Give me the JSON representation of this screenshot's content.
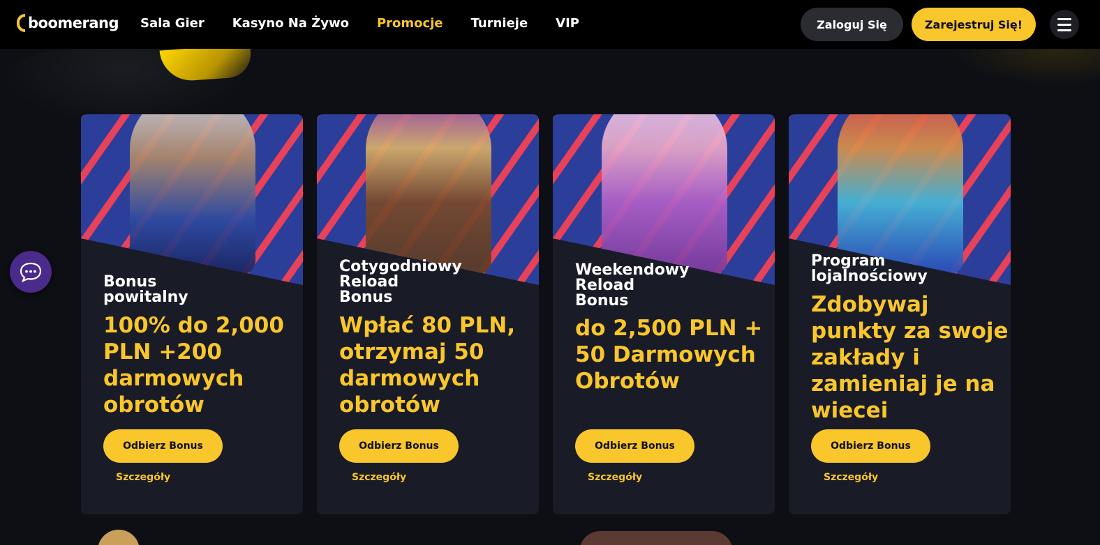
{
  "header": {
    "logo_text": "boomerang",
    "nav": [
      "Sala Gier",
      "Kasyno Na Żywo",
      "Promocje",
      "Turnieje",
      "VIP"
    ],
    "active_nav": "Promocje",
    "login_label": "Zaloguj Się",
    "register_label": "Zarejestruj Się!"
  },
  "cards": [
    {
      "title": "Bonus\npowitalny",
      "offer": "100% do 2,000 PLN +200 darmowych obrotów",
      "button_label": "Odbierz Bonus",
      "details_label": "Szczegóły"
    },
    {
      "title": "Cotygodniowy\nReload\nBonus",
      "offer": "Wpłać 80 PLN, otrzymaj 50 darmowych obrotów",
      "button_label": "Odbierz Bonus",
      "details_label": "Szczegóły"
    },
    {
      "title": "Weekendowy\nReload\nBonus",
      "offer": "do 2,500 PLN + 50 Darmowych Obrotów",
      "button_label": "Odbierz Bonus",
      "details_label": "Szczegóły"
    },
    {
      "title": "Program\nlojalnościowy",
      "offer": "Zdobywaj punkty za swoje zakłady i zamieniaj je na wiecei",
      "button_label": "Odbierz Bonus",
      "details_label": "Szczegóły"
    }
  ],
  "colors": {
    "accent": "#f9c62b",
    "card_bg": "#191b26",
    "page_bg": "#0d0f14",
    "art_blue": "#2b3e9a",
    "art_stripe": "#e8415a",
    "chat_bg": "#4a2a8a"
  },
  "icons": {
    "chat": "chat-bubble-icon",
    "menu": "hamburger-menu-icon"
  }
}
